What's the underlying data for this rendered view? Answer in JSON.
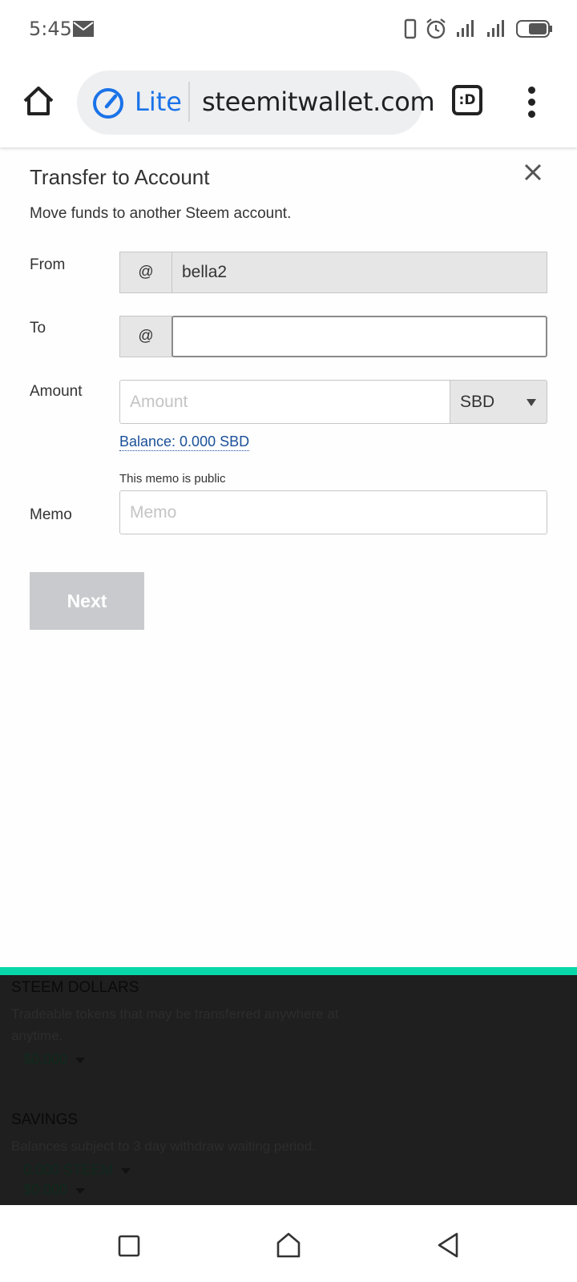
{
  "status_bar": {
    "time": "5:45"
  },
  "browser": {
    "lite_label": "Lite",
    "url": "steemitwallet.com",
    "tab_switcher_label": ":D"
  },
  "modal": {
    "title": "Transfer to Account",
    "subtitle": "Move funds to another Steem account.",
    "from": {
      "label": "From",
      "prefix": "@",
      "value": "bella2"
    },
    "to": {
      "label": "To",
      "prefix": "@",
      "value": ""
    },
    "amount": {
      "label": "Amount",
      "placeholder": "Amount",
      "asset": "SBD",
      "balance": "Balance: 0.000 SBD"
    },
    "memo": {
      "label": "Memo",
      "note": "This memo is public",
      "placeholder": "Memo"
    },
    "next_button": "Next"
  },
  "background": {
    "steem_dollars": {
      "title": "STEEM DOLLARS",
      "description": "Tradeable tokens that may be transferred anywhere at anytime.",
      "value": "$0.000"
    },
    "savings": {
      "title": "SAVINGS",
      "description": "Balances subject to 3 day withdraw waiting period.",
      "steem_value": "0.000 STEEM",
      "sbd_value": "$0.000"
    }
  },
  "colors": {
    "accent_blue": "#1a73e8",
    "link_blue": "#1a5099",
    "teal": "#07d7a9",
    "disabled_button": "#c8cacd"
  }
}
